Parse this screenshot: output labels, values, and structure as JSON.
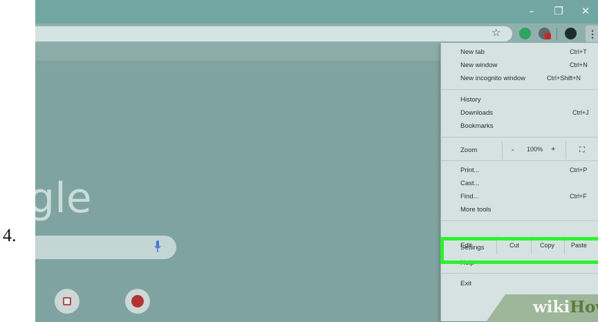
{
  "step": {
    "number": "4."
  },
  "window": {
    "controls": {
      "minimize": "–",
      "maximize": "❐",
      "close": "✕"
    }
  },
  "toolbar": {
    "star_icon": "☆",
    "menu_icon": "⋮"
  },
  "newtab": {
    "logo_text": "gle"
  },
  "menu": {
    "items": [
      {
        "id": "new-tab",
        "label": "New tab",
        "shortcut": "Ctrl+T"
      },
      {
        "id": "new-window",
        "label": "New window",
        "shortcut": "Ctrl+N"
      },
      {
        "id": "new-incognito",
        "label": "New incognito window",
        "shortcut": "Ctrl+Shift+N"
      },
      {
        "id": "history",
        "label": "History",
        "shortcut": ""
      },
      {
        "id": "downloads",
        "label": "Downloads",
        "shortcut": "Ctrl+J"
      },
      {
        "id": "bookmarks",
        "label": "Bookmarks",
        "shortcut": ""
      },
      {
        "id": "print",
        "label": "Print...",
        "shortcut": "Ctrl+P"
      },
      {
        "id": "cast",
        "label": "Cast...",
        "shortcut": ""
      },
      {
        "id": "find",
        "label": "Find...",
        "shortcut": "Ctrl+F"
      },
      {
        "id": "more-tools",
        "label": "More tools",
        "shortcut": ""
      },
      {
        "id": "settings",
        "label": "Settings",
        "shortcut": ""
      },
      {
        "id": "help",
        "label": "Help",
        "shortcut": ""
      },
      {
        "id": "exit",
        "label": "Exit",
        "shortcut": ""
      }
    ],
    "zoom": {
      "label": "Zoom",
      "minus": "-",
      "value": "100%",
      "plus": "+",
      "fullscreen": "⛶"
    },
    "edit": {
      "label": "Edit",
      "cut": "Cut",
      "copy": "Copy",
      "paste": "Paste"
    }
  },
  "watermark": {
    "part1": "wiki",
    "part2": "How"
  },
  "colors": {
    "highlight": "#2ff22f",
    "background": "#7ea3a0"
  }
}
